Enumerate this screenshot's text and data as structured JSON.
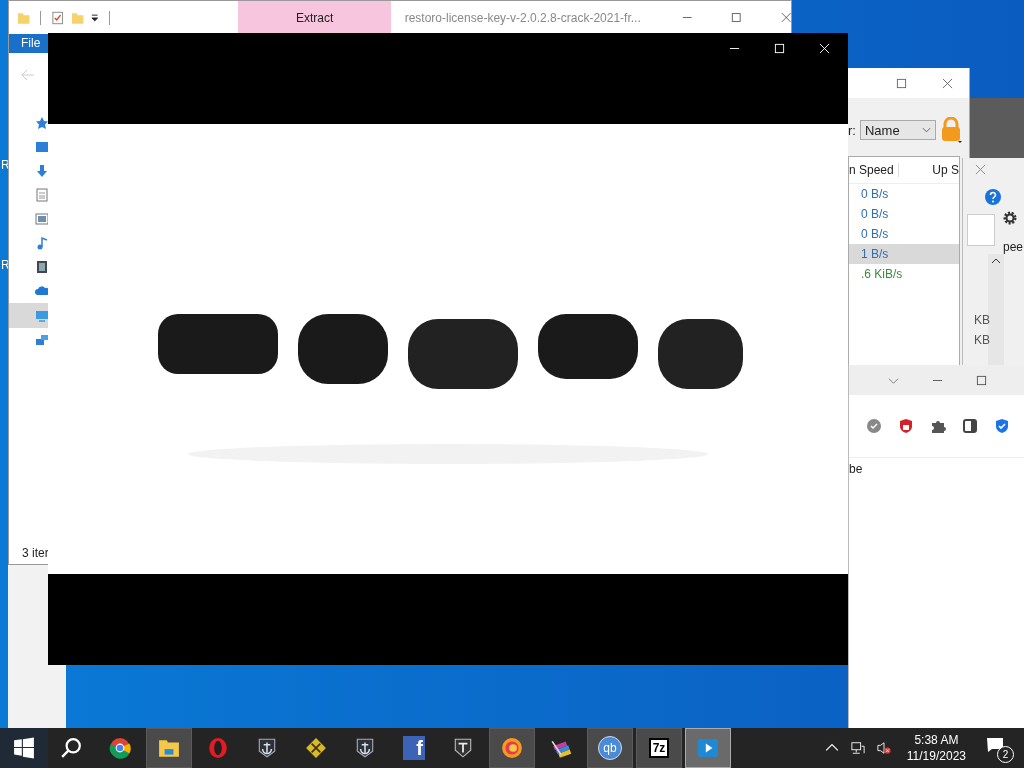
{
  "desktop": {
    "icon_labels": [
      "R",
      "R"
    ]
  },
  "explorer": {
    "contextual_tab": "Extract",
    "title": "restoro-license-key-v-2.0.2.8-crack-2021-fr...",
    "ribbon_tab": "File",
    "status": "3 iter",
    "nav_items": [
      {
        "kind": "quick",
        "selected": false
      },
      {
        "kind": "desktop",
        "selected": false
      },
      {
        "kind": "download",
        "selected": false
      },
      {
        "kind": "document",
        "selected": false
      },
      {
        "kind": "pictures",
        "selected": false
      },
      {
        "kind": "music",
        "selected": false
      },
      {
        "kind": "video",
        "selected": false
      },
      {
        "kind": "cloud",
        "selected": false
      },
      {
        "kind": "pc",
        "selected": true
      },
      {
        "kind": "network",
        "selected": false
      }
    ]
  },
  "qbittorrent": {
    "sort_label": "r:",
    "sort_value": "Name",
    "columns": [
      "n Speed",
      "Up S"
    ],
    "rows": [
      {
        "speed": "0 B/s",
        "color": "#2f6db5",
        "selected": false
      },
      {
        "speed": "0 B/s",
        "color": "#2f6db5",
        "selected": false
      },
      {
        "speed": "0 B/s",
        "color": "#2f6db5",
        "selected": false
      },
      {
        "speed": "1 B/s",
        "color": "#2f6db5",
        "selected": true
      },
      {
        "speed": ".6 KiB/s",
        "color": "#3a8a3a",
        "selected": false
      }
    ]
  },
  "side_window": {
    "column_3": "pee",
    "cells": [
      "KB",
      "KB"
    ]
  },
  "browser": {
    "text": "be"
  },
  "taskbar": {
    "apps": [
      {
        "kind": "chrome",
        "running": false,
        "selected": false
      },
      {
        "kind": "folder",
        "running": true,
        "selected": false
      },
      {
        "kind": "opera",
        "running": false,
        "selected": false
      },
      {
        "kind": "anchor",
        "running": false,
        "selected": false
      },
      {
        "kind": "diamond",
        "running": false,
        "selected": false
      },
      {
        "kind": "anchor",
        "running": false,
        "selected": false
      },
      {
        "kind": "facebook",
        "label": "f",
        "running": false,
        "selected": false
      },
      {
        "kind": "tank",
        "running": false,
        "selected": false
      },
      {
        "kind": "firefox",
        "running": true,
        "selected": false
      },
      {
        "kind": "archive",
        "running": false,
        "selected": false
      },
      {
        "kind": "badge",
        "label": "qb",
        "running": true,
        "selected": false
      },
      {
        "kind": "box",
        "label": "7z",
        "running": true,
        "selected": false
      },
      {
        "kind": "play",
        "running": true,
        "selected": true
      }
    ],
    "time": "5:38 AM",
    "date": "11/19/2023",
    "notifications": "2"
  }
}
